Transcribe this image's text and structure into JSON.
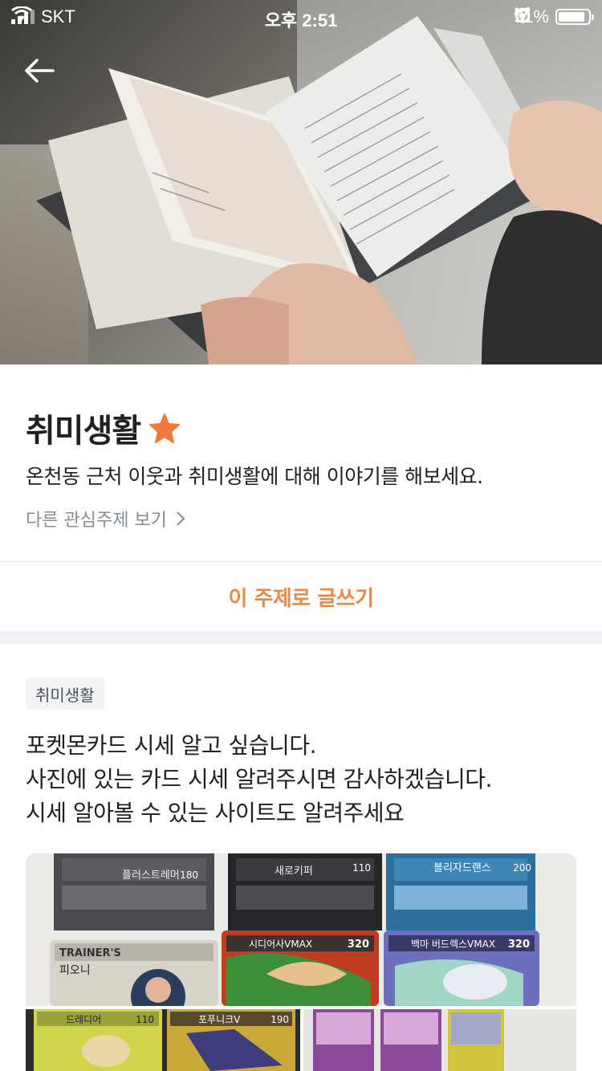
{
  "status_bar": {
    "carrier": "SKT",
    "time": "오후 2:51",
    "battery": "91%"
  },
  "topic": {
    "title": "취미생활",
    "description": "온천동 근처 이웃과 취미생활에 대해 이야기를 해보세요.",
    "other_topics_link": "다른 관심주제 보기"
  },
  "write_button": "이 주제로 글쓰기",
  "post": {
    "tag": "취미생활",
    "lines": [
      "포켓몬카드 시세 알고 싶습니다.",
      "사진에 있는 카드 시세 알려주시면 감사하겠습니다.",
      "시세 알아볼 수 있는 사이트도 알려주세요"
    ],
    "photo_cards": {
      "top_row": [
        "플러스트레머",
        "새로키퍼",
        "블리자드랜스"
      ],
      "top_hp": [
        "180",
        "110",
        "200"
      ],
      "mid_row": [
        "피오니",
        "시디어사VMAX",
        "백마 버드렉스VMAX"
      ],
      "mid_hp": [
        "",
        "320",
        "320"
      ],
      "trainer_label": "TRAINER'S",
      "bottom_row": [
        "드레디어",
        "포푸니크V"
      ],
      "bottom_hp": [
        "110",
        "190"
      ]
    }
  },
  "colors": {
    "accent": "#e78a4a",
    "star": "#f07b3a",
    "muted_text": "#868b94",
    "gap_bg": "#f2f3f6"
  },
  "icons": [
    "back-arrow-icon",
    "star-icon",
    "chevron-right-icon",
    "wifi-icon",
    "location-icon",
    "alarm-icon",
    "orientation-lock-icon"
  ]
}
